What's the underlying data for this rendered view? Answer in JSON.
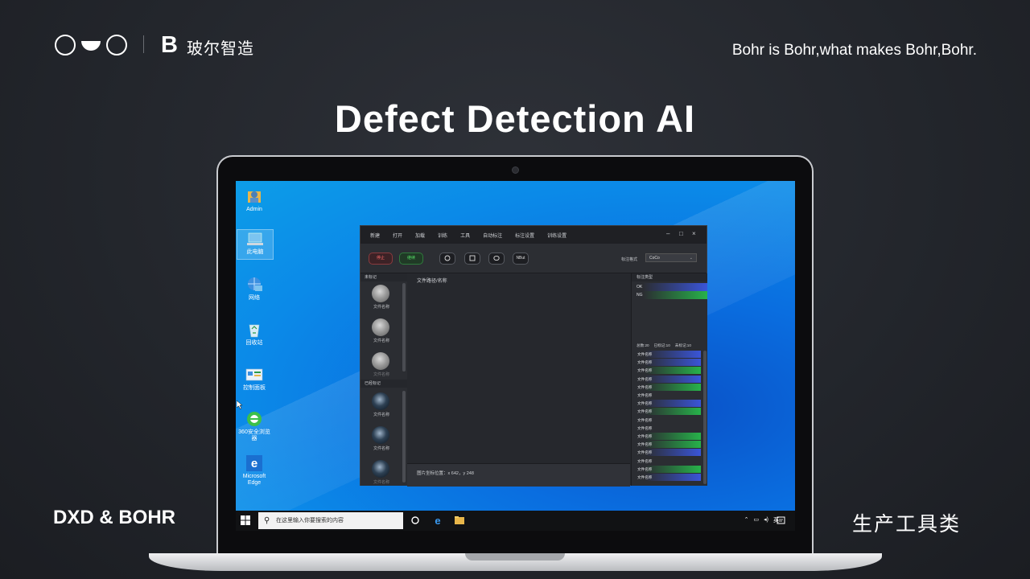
{
  "brand": {
    "b_letter": "B",
    "name": "玻尔智造",
    "tagline": "Bohr is Bohr,what makes Bohr,Bohr."
  },
  "main_title": "Defect Detection AI",
  "footer": {
    "left": "DXD & BOHR",
    "right": "生产工具类"
  },
  "desktop": {
    "icons": [
      {
        "label": "Admin"
      },
      {
        "label": "此电脑"
      },
      {
        "label": "网络"
      },
      {
        "label": "回收站"
      },
      {
        "label": "控制面板"
      },
      {
        "label": "360安全浏览器"
      },
      {
        "label": "Microsoft Edge"
      }
    ]
  },
  "app": {
    "menu": [
      "新建",
      "打开",
      "加载",
      "训练",
      "工具",
      "自动标注",
      "标注设置",
      "训练设置"
    ],
    "window_controls": {
      "minimize": "–",
      "maximize": "□",
      "close": "×"
    },
    "toolbar": {
      "stop": "停止",
      "continue": "继续",
      "shape_nbut": "NBut",
      "format_label": "标注格式",
      "format_value": "CoCo"
    },
    "left_pane": {
      "unmarked_title": "未标记",
      "marked_title": "已经标记",
      "unmarked_items": [
        "文件名称",
        "文件名称",
        "文件名称"
      ],
      "marked_items": [
        "文件名称",
        "文件名称",
        "文件名称"
      ]
    },
    "canvas_title": "文件路径/名称",
    "status": "图片坐标位置：x 642，y 248",
    "right_pane": {
      "label_types_title": "标注类型",
      "label_types": [
        "OK",
        "NG"
      ],
      "counts": {
        "total": "总数:20",
        "marked": "已标记:10",
        "unmarked": "未标记:10"
      },
      "file_rows": [
        "文件名称",
        "文件名称",
        "文件名称",
        "文件名称",
        "文件名称",
        "文件名称",
        "文件名称",
        "文件名称",
        "文件名称",
        "文件名称",
        "文件名称",
        "文件名称",
        "文件名称",
        "文件名称",
        "文件名称",
        "文件名称"
      ]
    }
  },
  "taskbar": {
    "search_placeholder": "在这里输入你要搜索的内容",
    "ime": "英"
  },
  "colors": {
    "accent_green": "#27b24a",
    "accent_blue": "#3a55d8",
    "stop_red": "#ff6a6a"
  }
}
